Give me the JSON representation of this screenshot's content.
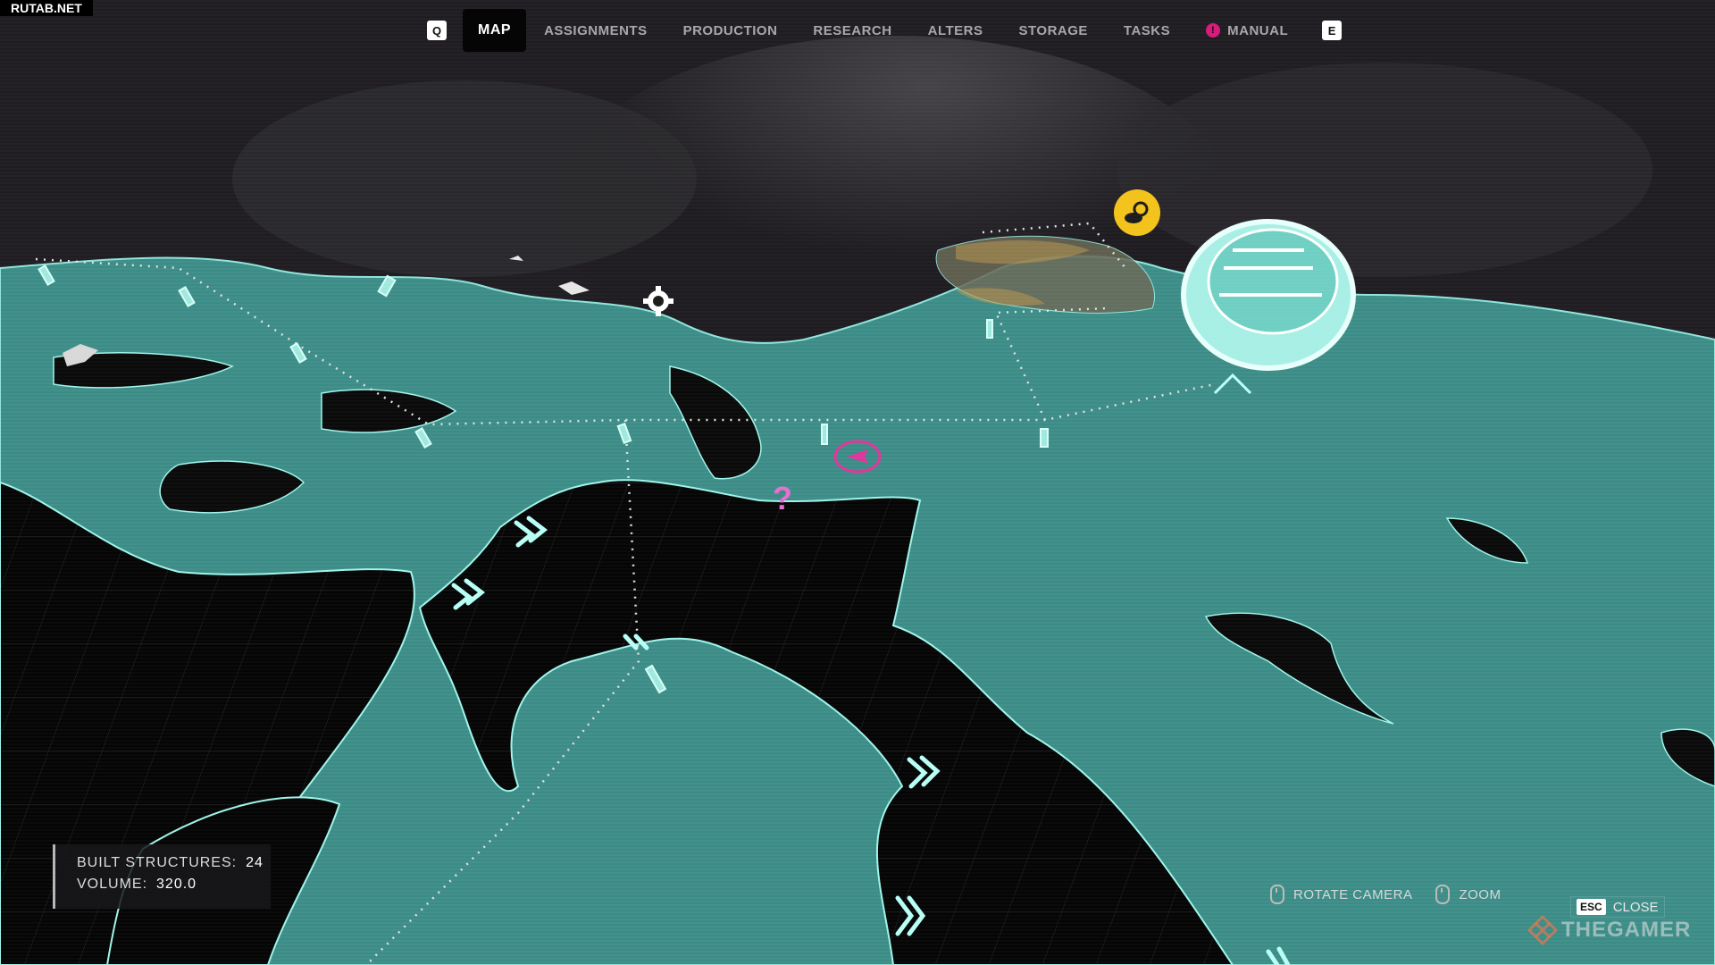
{
  "watermark_top": "RUTAB.NET",
  "nav": {
    "left_key": "Q",
    "right_key": "E",
    "tabs": [
      {
        "label": "MAP",
        "active": true
      },
      {
        "label": "ASSIGNMENTS"
      },
      {
        "label": "PRODUCTION"
      },
      {
        "label": "RESEARCH"
      },
      {
        "label": "ALTERS"
      },
      {
        "label": "STORAGE"
      },
      {
        "label": "TASKS"
      },
      {
        "label": "MANUAL",
        "alert": "!"
      }
    ]
  },
  "stats": {
    "built_label": "BUILT STRUCTURES:",
    "built_value": "24",
    "volume_label": "VOLUME:",
    "volume_value": "320.0"
  },
  "hints": {
    "rotate": "ROTATE CAMERA",
    "zoom": "ZOOM",
    "close_key": "ESC",
    "close": "CLOSE"
  },
  "watermark_bottom": "THEGAMER",
  "map_markers": {
    "unknown": "?"
  },
  "icons": [
    "weather-icon",
    "gear-icon",
    "player-marker-icon",
    "mouse-icon",
    "thegamer-logo-icon",
    "chevron-icon"
  ],
  "colors": {
    "land": "#3c8c86",
    "water": "#050505",
    "fog": "#2a272c",
    "accent_pink": "#e0359a",
    "accent_yellow": "#f3c21b",
    "highlight": "#9ff5ea"
  }
}
